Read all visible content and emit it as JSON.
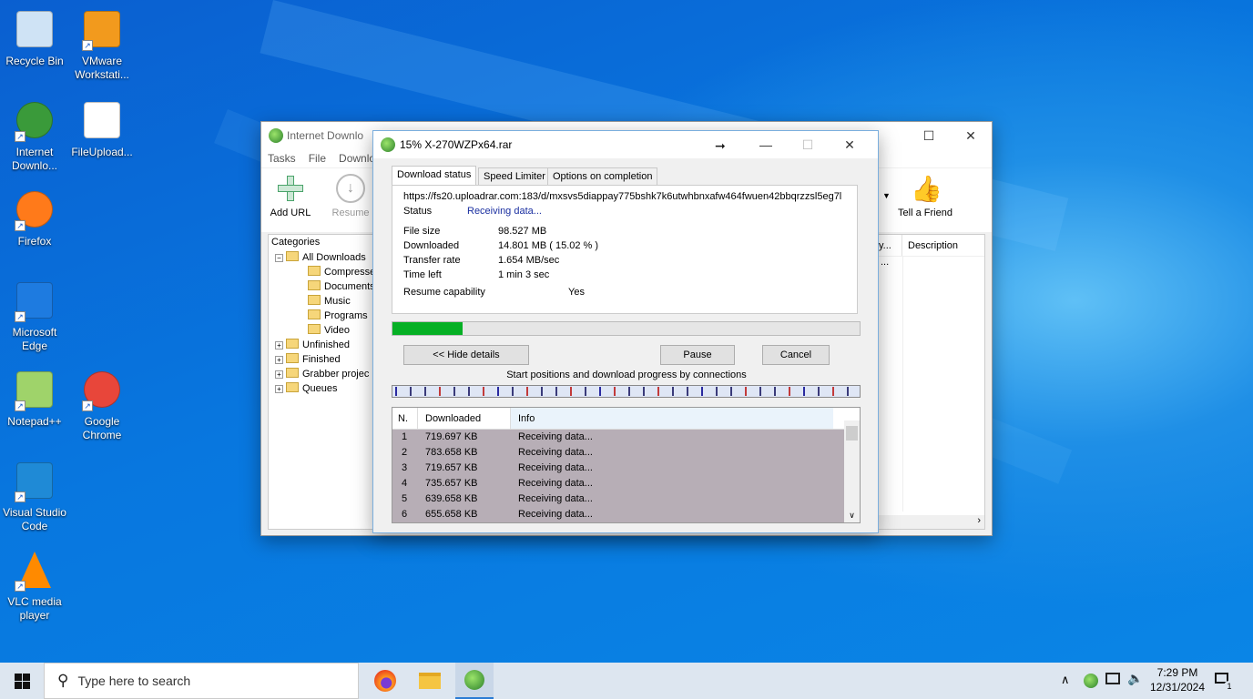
{
  "desktop": {
    "icons": [
      {
        "label": "Recycle Bin",
        "icon": "recycle-bin-icon"
      },
      {
        "label": "VMware Workstati...",
        "icon": "vmware-icon"
      },
      {
        "label": "Internet Downlo...",
        "icon": "idm-icon"
      },
      {
        "label": "FileUpload...",
        "icon": "file-icon"
      },
      {
        "label": "Firefox",
        "icon": "firefox-icon"
      },
      {
        "label": "Microsoft Edge",
        "icon": "edge-icon"
      },
      {
        "label": "Notepad++",
        "icon": "notepadpp-icon"
      },
      {
        "label": "Google Chrome",
        "icon": "chrome-icon"
      },
      {
        "label": "Visual Studio Code",
        "icon": "vscode-icon"
      },
      {
        "label": "VLC media player",
        "icon": "vlc-icon"
      }
    ]
  },
  "idm_main": {
    "title": "Internet Downlo",
    "menu": [
      "Tasks",
      "File",
      "Downlo"
    ],
    "toolbar": {
      "add_url": "Add URL",
      "resume": "Resume",
      "tell_friend": "Tell a Friend"
    },
    "categories_label": "Categories",
    "tree": [
      "All Downloads",
      "Compresse",
      "Documents",
      "Music",
      "Programs",
      "Video",
      "Unfinished",
      "Finished",
      "Grabber projec",
      "Queues"
    ],
    "columns": {
      "col1": "y...",
      "description": "Description"
    },
    "row_cell": "..."
  },
  "dialog": {
    "title": "15% X-270WZPx64.rar",
    "tabs": [
      "Download status",
      "Speed Limiter",
      "Options on completion"
    ],
    "url": "https://fs20.uploadrar.com:183/d/mxsvs5diappay775bshk7k6utwhbnxafw464fwuen42bbqrzzsl5eg7l",
    "status_label": "Status",
    "status_value": "Receiving data...",
    "file_size_label": "File size",
    "file_size_value": "98.527  MB",
    "downloaded_label": "Downloaded",
    "downloaded_value": "14.801  MB  ( 15.02 % )",
    "rate_label": "Transfer rate",
    "rate_value": "1.654  MB/sec",
    "time_left_label": "Time left",
    "time_left_value": "1 min 3 sec",
    "resume_label": "Resume capability",
    "resume_value": "Yes",
    "progress_fraction": 0.1502,
    "hide_details": "<< Hide details",
    "pause": "Pause",
    "cancel": "Cancel",
    "connections_caption": "Start positions and download progress by connections",
    "table": {
      "headers": [
        "N.",
        "Downloaded",
        "Info"
      ],
      "rows": [
        [
          "1",
          "719.697  KB",
          "Receiving data..."
        ],
        [
          "2",
          "783.658  KB",
          "Receiving data..."
        ],
        [
          "3",
          "719.657  KB",
          "Receiving data..."
        ],
        [
          "4",
          "735.657  KB",
          "Receiving data..."
        ],
        [
          "5",
          "639.658  KB",
          "Receiving data..."
        ],
        [
          "6",
          "655.658  KB",
          "Receiving data..."
        ]
      ]
    }
  },
  "taskbar": {
    "search_placeholder": "Type here to search",
    "time": "7:29 PM",
    "date": "12/31/2024",
    "notification_count": "1"
  }
}
